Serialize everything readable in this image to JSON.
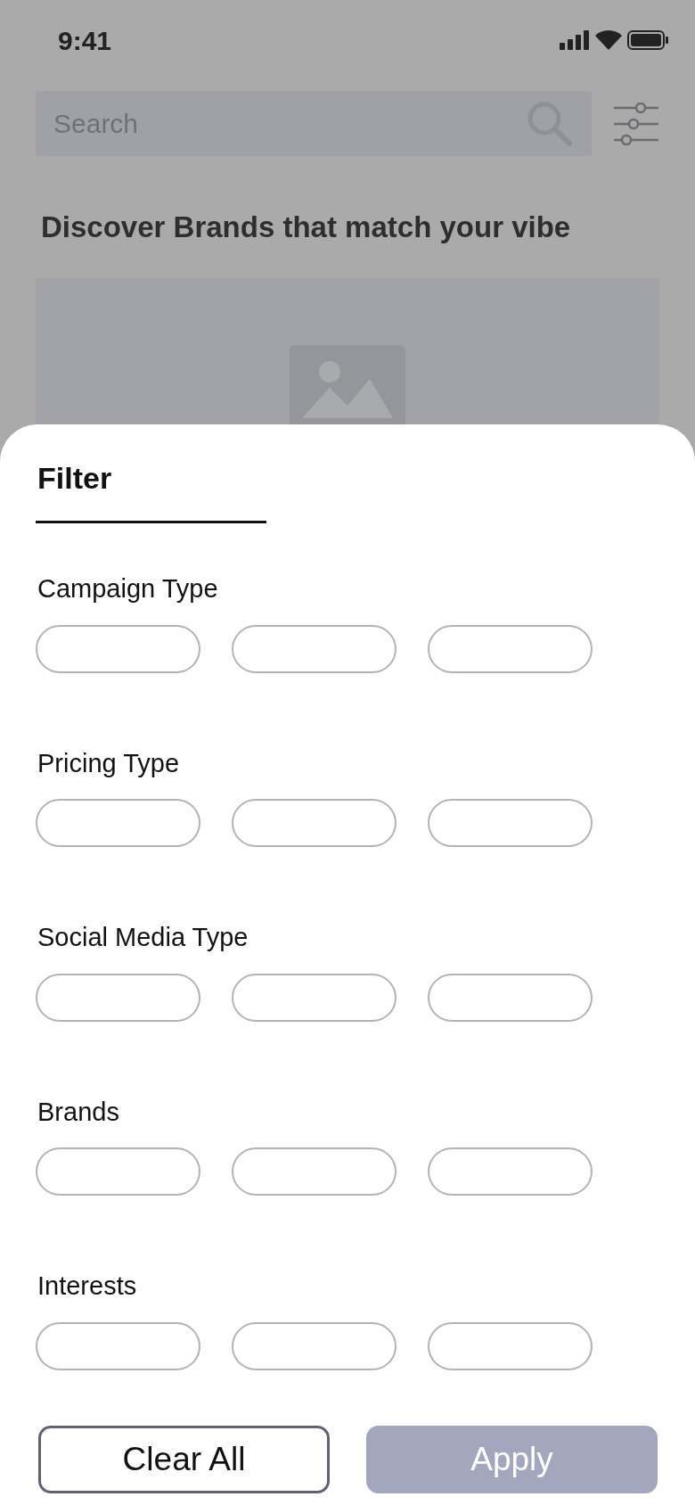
{
  "status_bar": {
    "time": "9:41"
  },
  "search": {
    "placeholder": "Search"
  },
  "heading": "Discover Brands that match your vibe",
  "filter_sheet": {
    "title": "Filter",
    "sections": [
      {
        "label": "Campaign Type"
      },
      {
        "label": "Pricing Type"
      },
      {
        "label": "Social Media Type"
      },
      {
        "label": "Brands"
      },
      {
        "label": "Interests"
      }
    ],
    "buttons": [
      {
        "kind": "outline",
        "label": "Clear All"
      },
      {
        "kind": "filled",
        "label": "Apply"
      }
    ]
  }
}
